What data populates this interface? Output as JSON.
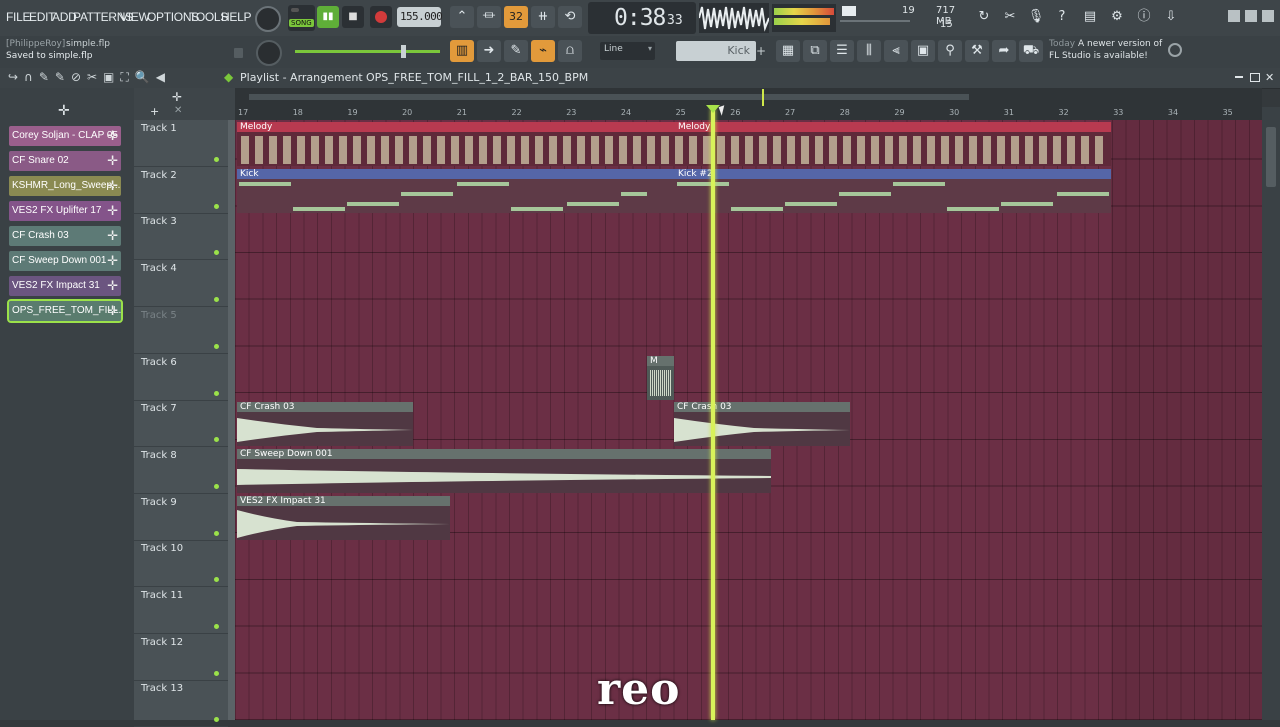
{
  "menu": {
    "items": [
      "FILE",
      "EDIT",
      "ADD",
      "PATTERNS",
      "VIEW",
      "OPTIONS",
      "TOOLS",
      "HELP"
    ]
  },
  "transport": {
    "mode": "SONG",
    "tempo": "155.000",
    "time": "0:38",
    "time_sub": "33",
    "pattern_num": "32"
  },
  "status": {
    "cpu_voices": "19",
    "memory": "717 MB",
    "polyphony": "15"
  },
  "hint": {
    "user": "[PhilippeRoy]",
    "file": "simple.flp",
    "saved": "Saved to simple.flp"
  },
  "snap": {
    "mode": "Line",
    "channel": "Kick"
  },
  "news": {
    "label": "Today",
    "message1": "A newer version of",
    "message2": "FL Studio is available!"
  },
  "playlist": {
    "title": "Playlist - Arrangement",
    "separator": "›",
    "pattern": "OPS_FREE_TOM_FILL_1_2_BAR_150_BPM"
  },
  "clips": [
    {
      "label": "Corey Soljan - CLAP 05",
      "color": "#9a5f8c"
    },
    {
      "label": "CF Snare 02",
      "color": "#8a5a86"
    },
    {
      "label": "KSHMR_Long_Sweep...",
      "color": "#8a8a52"
    },
    {
      "label": "VES2 FX Uplifter 17",
      "color": "#84548a"
    },
    {
      "label": "CF Crash 03",
      "color": "#5d7a76"
    },
    {
      "label": "CF Sweep Down 001",
      "color": "#5d7a76"
    },
    {
      "label": "VES2 FX Impact 31",
      "color": "#6b5580"
    },
    {
      "label": "OPS_FREE_TOM_FILL...",
      "color": "#5a7c6e"
    }
  ],
  "ruler": [
    "17",
    "18",
    "19",
    "20",
    "21",
    "22",
    "23",
    "24",
    "25",
    "26",
    "27",
    "28",
    "29",
    "30",
    "31",
    "32",
    "33",
    "34",
    "35"
  ],
  "tracks": [
    "Track 1",
    "Track 2",
    "Track 3",
    "Track 4",
    "Track 5",
    "Track 6",
    "Track 7",
    "Track 8",
    "Track 9",
    "Track 10",
    "Track 11",
    "Track 12",
    "Track 13"
  ],
  "patterns": {
    "melody1": "Melody",
    "melody2": "Melody",
    "kick1": "Kick",
    "kick2": "Kick #2",
    "crash1": "CF Crash 03",
    "crash2": "CF Crash 03",
    "sweep": "CF Sweep Down 001",
    "impact": "VES2 FX Impact 31",
    "tiny": "M"
  },
  "watermark": "reo"
}
